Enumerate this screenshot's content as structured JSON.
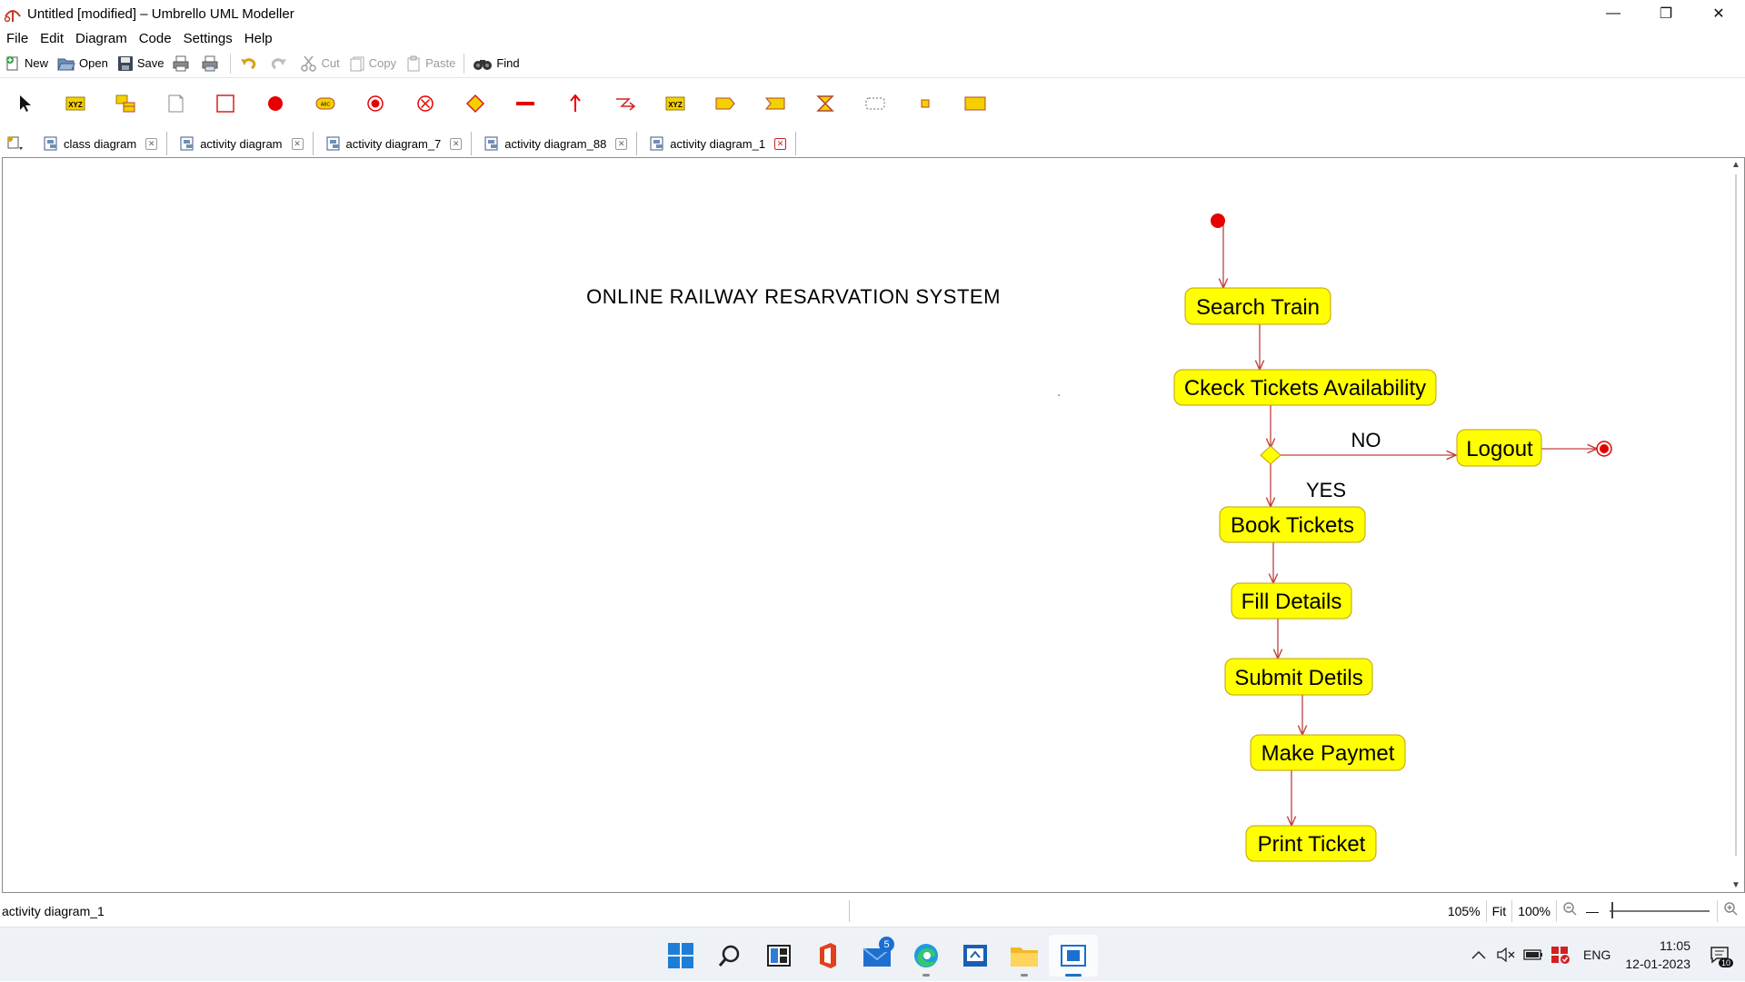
{
  "window": {
    "title": "Untitled [modified] – Umbrello UML Modeller",
    "controls": {
      "minimize": "—",
      "restore": "❐",
      "close": "✕"
    }
  },
  "menu": [
    "File",
    "Edit",
    "Diagram",
    "Code",
    "Settings",
    "Help"
  ],
  "toolbar": {
    "new_label": "New",
    "open_label": "Open",
    "save_label": "Save",
    "cut_label": "Cut",
    "copy_label": "Copy",
    "paste_label": "Paste",
    "find_label": "Find"
  },
  "palette": {
    "icons": [
      "select-arrow-icon",
      "object-xyz-icon",
      "class-box-icon",
      "note-icon",
      "box-icon",
      "initial-state-icon",
      "activity-icon",
      "end-activity-icon",
      "final-activity-icon",
      "branch-diamond-icon",
      "fork-bar-icon",
      "anchor-arrow-icon",
      "exception-icon",
      "object-node-icon",
      "send-signal-icon",
      "accept-signal-icon",
      "accept-time-icon",
      "region-icon",
      "pin-icon",
      "partition-icon"
    ]
  },
  "tabs": [
    {
      "label": "class diagram",
      "active": false
    },
    {
      "label": "activity diagram",
      "active": false
    },
    {
      "label": "activity diagram_7",
      "active": false
    },
    {
      "label": "activity diagram_88",
      "active": false
    },
    {
      "label": "activity diagram_1",
      "active": true
    }
  ],
  "diagram": {
    "title": "ONLINE RAILWAY RESARVATION SYSTEM",
    "activities": {
      "search_train": "Search Train",
      "check_availability": "Ckeck Tickets Availability",
      "logout": "Logout",
      "book_tickets": "Book Tickets",
      "fill_details": "Fill Details",
      "submit_details": "Submit Detils",
      "make_payment": "Make Paymet",
      "print_ticket": "Print Ticket"
    },
    "guards": {
      "no": "NO",
      "yes": "YES"
    },
    "colors": {
      "activity_fill": "#ffff00",
      "activity_border": "#c0a000",
      "edge": "#c04040",
      "node_red": "#e60000"
    }
  },
  "status": {
    "current_diagram": "activity diagram_1",
    "zoom_level": "105%",
    "fit_label": "Fit",
    "zoom_100_label": "100%"
  },
  "taskbar": {
    "mail_badge": "5",
    "language": "ENG",
    "time": "11:05",
    "date": "12-01-2023",
    "notifications": "10"
  }
}
